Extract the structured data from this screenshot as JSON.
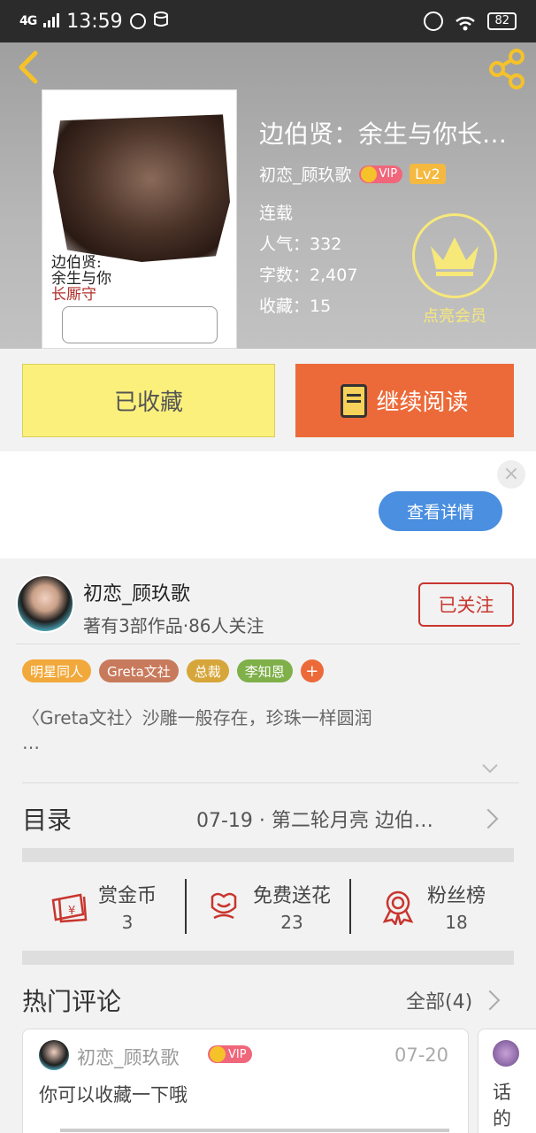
{
  "status_bar": {
    "network": "4G",
    "time": "13:59",
    "battery": "82"
  },
  "book": {
    "title": "边伯贤：余生与你长…",
    "author": "初恋_顾玖歌",
    "vip_label": "VIP",
    "level": "Lv2",
    "status": "连载",
    "popularity_label": "人气：",
    "popularity": "332",
    "words_label": "字数：",
    "words": "2,407",
    "favorites_label": "收藏：",
    "favorites": "15",
    "member_label": "点亮会员",
    "cover": {
      "title_line1": "边伯贤:",
      "title_line2": "余生与你",
      "title_line3": "长厮守"
    }
  },
  "actions": {
    "collected_label": "已收藏",
    "continue_label": "继续阅读"
  },
  "ad": {
    "close": "×",
    "detail_label": "查看详情"
  },
  "author_card": {
    "name": "初恋_顾玖歌",
    "stats": "著有3部作品·86人关注",
    "follow_label": "已关注",
    "tags": [
      {
        "label": "明星同人",
        "color": "#f2a93b"
      },
      {
        "label": "Greta文社",
        "color": "#c87a5c"
      },
      {
        "label": "总裁",
        "color": "#d6a63a"
      },
      {
        "label": "李知恩",
        "color": "#7fb04a"
      }
    ],
    "tag_more": "+",
    "tag_more_color": "#ec6a39",
    "description_line1": "〈Greta文社〉沙雕一般存在，珍珠一样圆润",
    "description_line2": "…"
  },
  "catalog": {
    "title": "目录",
    "latest": "07-19 · 第二轮月亮 边伯…"
  },
  "stats": {
    "reward_label": "赏金币",
    "reward_value": "3",
    "flower_label": "免费送花",
    "flower_value": "23",
    "fans_label": "粉丝榜",
    "fans_value": "18"
  },
  "comments": {
    "title": "热门评论",
    "all_label": "全部(4)",
    "items": [
      {
        "user": "初恋_顾玖歌",
        "vip": "VIP",
        "date": "07-20",
        "text": "你可以收藏一下哦"
      },
      {
        "text": "话的"
      }
    ]
  },
  "colors": {
    "accent_orange": "#ec6a39",
    "collect_yellow": "#fbf07c",
    "follow_red": "#c8352e",
    "detail_blue": "#4a8fe0"
  }
}
